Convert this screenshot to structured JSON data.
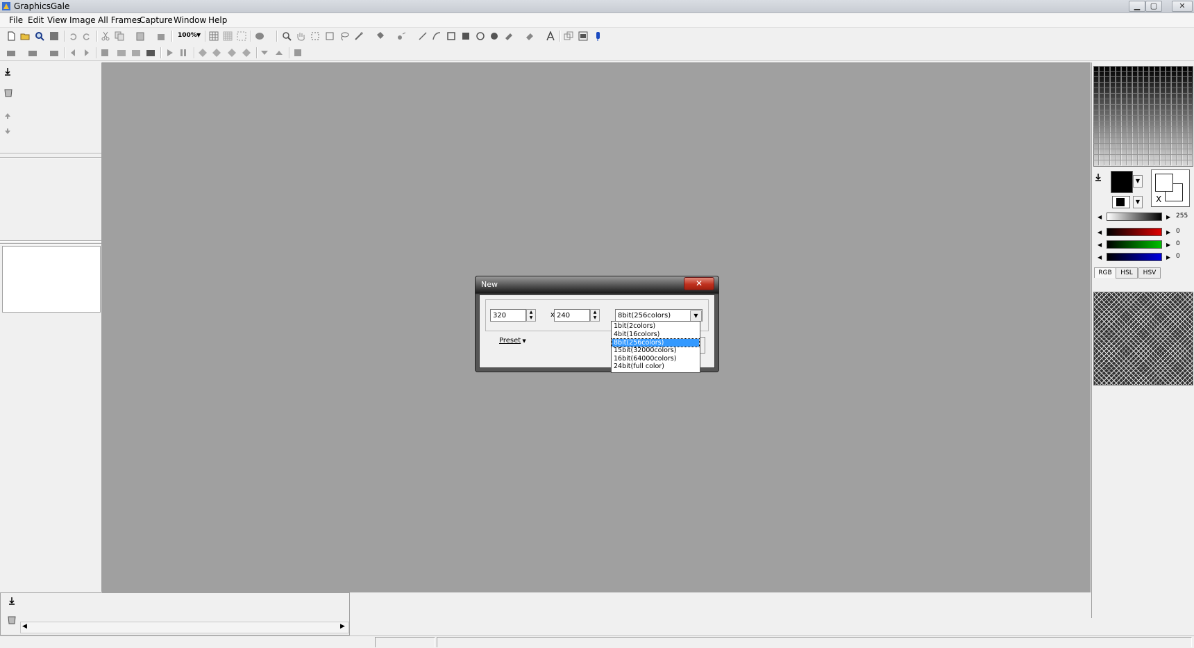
{
  "window": {
    "title": "GraphicsGale"
  },
  "menu": {
    "items": [
      "File",
      "Edit",
      "View",
      "Image",
      "All Frames",
      "Capture",
      "Window",
      "Help"
    ]
  },
  "toolbar": {
    "zoom_label": "100%"
  },
  "palette_panel": {
    "gray_value": "255",
    "red_value": "0",
    "green_value": "0",
    "blue_value": "0",
    "transparent_marker": "X",
    "tabs": [
      "RGB",
      "HSL",
      "HSV"
    ],
    "colors": {
      "accent_red": "#e00000",
      "accent_green": "#00c000",
      "accent_blue": "#0000e0",
      "selection": "#3399ff"
    }
  },
  "dialog": {
    "title": "New",
    "close_label": "✕",
    "width_value": "320",
    "height_value": "240",
    "times_label": "x",
    "color_depth_value": "8bit(256colors)",
    "preset_label": "Preset",
    "color_depth_options": [
      "1bit(2colors)",
      "4bit(16colors)",
      "8bit(256colors)",
      "15bit(32000colors)",
      "16bit(64000colors)",
      "24bit(full color)"
    ],
    "selected_option": "8bit(256colors)"
  },
  "icons": {
    "toolbar1": [
      "new-file-icon",
      "open-folder-icon",
      "magnifier-icon",
      "save-icon",
      "undo-icon",
      "redo-icon",
      "cut-icon",
      "copy-icon",
      "paste-icon",
      "delete-icon",
      "zoom-icon",
      "grid-icon",
      "pixel-grid-icon",
      "resize-icon",
      "palette-icon",
      "zoom-tool-icon",
      "hand-icon",
      "rect-select-icon",
      "free-select-icon",
      "lasso-icon",
      "magic-wand-icon",
      "fill-icon",
      "spray-icon",
      "line-icon",
      "curve-icon",
      "rectangle-icon",
      "filled-rectangle-icon",
      "ellipse-icon",
      "filled-ellipse-icon",
      "brush-icon",
      "eraser-icon",
      "text-icon",
      "window-icon",
      "frame-icon",
      "pen-icon"
    ],
    "toolbar2": [
      "layer-new-icon",
      "layer-copy-icon",
      "layer-merge-icon",
      "prev-frame-icon",
      "next-frame-icon",
      "frame-icon",
      "frame-copy-icon",
      "frame-paste-icon",
      "frame-delete-icon",
      "play-icon",
      "pause-icon",
      "layer-add-icon",
      "layer-stack-icon",
      "layer-remove-icon",
      "layer-effect-icon",
      "move-down-icon",
      "move-up-icon",
      "layer-properties-icon"
    ]
  }
}
